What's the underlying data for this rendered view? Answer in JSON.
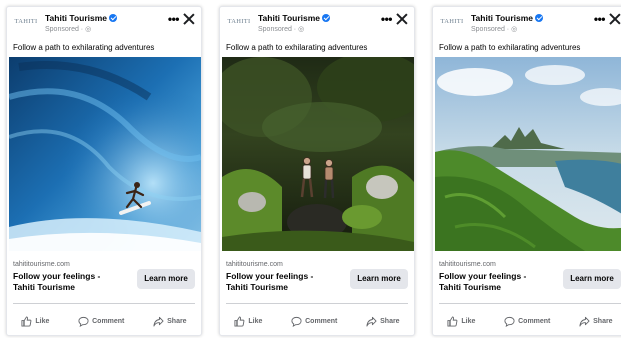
{
  "ads": [
    {
      "page_name": "Tahiti Tourisme",
      "logo_text": "TAHITI",
      "sponsored": "Sponsored · ",
      "headline": "Follow a path to exhilarating adventures",
      "domain": "tahititourisme.com",
      "cta_title": "Follow your feelings - Tahiti Tourisme",
      "cta_button": "Learn more",
      "actions": {
        "like": "Like",
        "comment": "Comment",
        "share": "Share"
      }
    },
    {
      "page_name": "Tahiti Tourisme",
      "logo_text": "TAHITI",
      "sponsored": "Sponsored · ",
      "headline": "Follow a path to exhilarating adventures",
      "domain": "tahititourisme.com",
      "cta_title": "Follow your feelings - Tahiti Tourisme",
      "cta_button": "Learn more",
      "actions": {
        "like": "Like",
        "comment": "Comment",
        "share": "Share"
      }
    },
    {
      "page_name": "Tahiti Tourisme",
      "logo_text": "TAHITI",
      "sponsored": "Sponsored · ",
      "headline": "Follow a path to exhilarating adventures",
      "domain": "tahititourisme.com",
      "cta_title": "Follow your feelings - Tahiti Tourisme",
      "cta_button": "Learn more",
      "actions": {
        "like": "Like",
        "comment": "Comment",
        "share": "Share"
      }
    }
  ],
  "icons": {
    "verified": "verified-badge-icon",
    "more": "more-options-icon",
    "close": "close-icon",
    "globe": "globe-icon",
    "like": "thumbs-up-icon",
    "comment": "comment-bubble-icon",
    "share": "share-arrow-icon"
  },
  "colors": {
    "verified_blue": "#1877f2",
    "button_bg": "#e4e6eb",
    "muted_text": "#65676b"
  }
}
